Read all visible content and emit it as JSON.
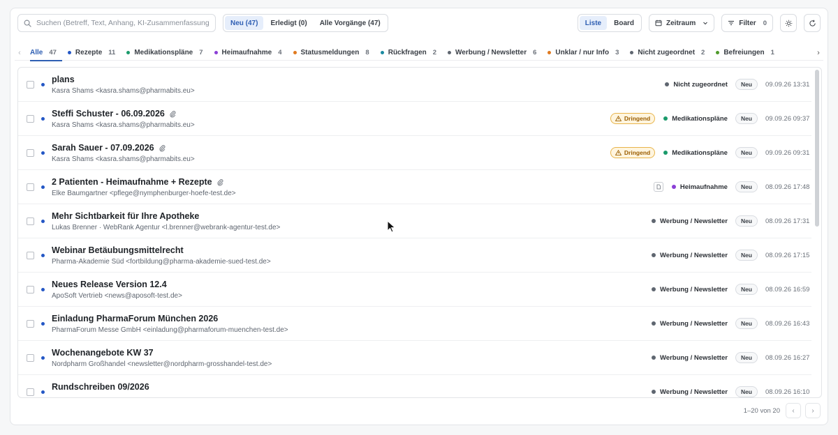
{
  "search": {
    "placeholder": "Suchen (Betreff, Text, Anhang, KI-Zusammenfassung) …",
    "value": ""
  },
  "status_filter": [
    {
      "label": "Neu (47)",
      "active": true
    },
    {
      "label": "Erledigt (0)",
      "active": false
    },
    {
      "label": "Alle Vorgänge (47)",
      "active": false
    }
  ],
  "view": {
    "list_label": "Liste",
    "board_label": "Board",
    "active": "Liste"
  },
  "timerange": {
    "label": "Zeitraum"
  },
  "filter": {
    "label": "Filter",
    "count": "0"
  },
  "categories": [
    {
      "label": "Alle",
      "count": "47",
      "active": true,
      "color": null
    },
    {
      "label": "Rezepte",
      "count": "11",
      "color": "#2457c5"
    },
    {
      "label": "Medikationspläne",
      "count": "7",
      "color": "#1a9a6b"
    },
    {
      "label": "Heimaufnahme",
      "count": "4",
      "color": "#8b3fd6"
    },
    {
      "label": "Statusmeldungen",
      "count": "8",
      "color": "#e07a1f"
    },
    {
      "label": "Rückfragen",
      "count": "2",
      "color": "#1a8aa0"
    },
    {
      "label": "Werbung / Newsletter",
      "count": "6",
      "color": "#5f6670"
    },
    {
      "label": "Unklar / nur Info",
      "count": "3",
      "color": "#e07a1f"
    },
    {
      "label": "Nicht zugeordnet",
      "count": "2",
      "color": "#5f6670"
    },
    {
      "label": "Befreiungen",
      "count": "1",
      "color": "#4f9a2a"
    }
  ],
  "rows": [
    {
      "subject": "plans",
      "attachment": false,
      "sender": "Kasra Shams <kasra.shams@pharmabits.eu>",
      "urgent": false,
      "doc": false,
      "category": "Nicht zugeordnet",
      "category_color": "#5f6670",
      "status": "Neu",
      "date": "09.09.26 13:31"
    },
    {
      "subject": "Steffi Schuster - 06.09.2026",
      "attachment": true,
      "sender": "Kasra Shams <kasra.shams@pharmabits.eu>",
      "urgent": true,
      "doc": false,
      "category": "Medikationspläne",
      "category_color": "#1a9a6b",
      "status": "Neu",
      "date": "09.09.26 09:37"
    },
    {
      "subject": "Sarah Sauer - 07.09.2026",
      "attachment": true,
      "sender": "Kasra Shams <kasra.shams@pharmabits.eu>",
      "urgent": true,
      "doc": false,
      "category": "Medikationspläne",
      "category_color": "#1a9a6b",
      "status": "Neu",
      "date": "09.09.26 09:31"
    },
    {
      "subject": "2 Patienten - Heimaufnahme + Rezepte",
      "attachment": true,
      "sender": "Elke Baumgartner <pflege@nymphenburger-hoefe-test.de>",
      "urgent": false,
      "doc": true,
      "category": "Heimaufnahme",
      "category_color": "#8b3fd6",
      "status": "Neu",
      "date": "08.09.26 17:48"
    },
    {
      "subject": "Mehr Sichtbarkeit für Ihre Apotheke",
      "attachment": false,
      "sender": "Lukas Brenner · WebRank Agentur <l.brenner@webrank-agentur-test.de>",
      "urgent": false,
      "doc": false,
      "category": "Werbung / Newsletter",
      "category_color": "#5f6670",
      "status": "Neu",
      "date": "08.09.26 17:31"
    },
    {
      "subject": "Webinar Betäubungsmittelrecht",
      "attachment": false,
      "sender": "Pharma-Akademie Süd <fortbildung@pharma-akademie-sued-test.de>",
      "urgent": false,
      "doc": false,
      "category": "Werbung / Newsletter",
      "category_color": "#5f6670",
      "status": "Neu",
      "date": "08.09.26 17:15"
    },
    {
      "subject": "Neues Release Version 12.4",
      "attachment": false,
      "sender": "ApoSoft Vertrieb <news@aposoft-test.de>",
      "urgent": false,
      "doc": false,
      "category": "Werbung / Newsletter",
      "category_color": "#5f6670",
      "status": "Neu",
      "date": "08.09.26 16:59"
    },
    {
      "subject": "Einladung PharmaForum München 2026",
      "attachment": false,
      "sender": "PharmaForum Messe GmbH <einladung@pharmaforum-muenchen-test.de>",
      "urgent": false,
      "doc": false,
      "category": "Werbung / Newsletter",
      "category_color": "#5f6670",
      "status": "Neu",
      "date": "08.09.26 16:43"
    },
    {
      "subject": "Wochenangebote KW 37",
      "attachment": false,
      "sender": "Nordpharm Großhandel <newsletter@nordpharm-grosshandel-test.de>",
      "urgent": false,
      "doc": false,
      "category": "Werbung / Newsletter",
      "category_color": "#5f6670",
      "status": "Neu",
      "date": "08.09.26 16:27"
    },
    {
      "subject": "Rundschreiben 09/2026",
      "attachment": false,
      "sender": "",
      "urgent": false,
      "doc": false,
      "category": "Werbung / Newsletter",
      "category_color": "#5f6670",
      "status": "Neu",
      "date": "08.09.26 16:10"
    }
  ],
  "urgent_label": "Dringend",
  "pagination": {
    "range": "1–20 von 20"
  }
}
